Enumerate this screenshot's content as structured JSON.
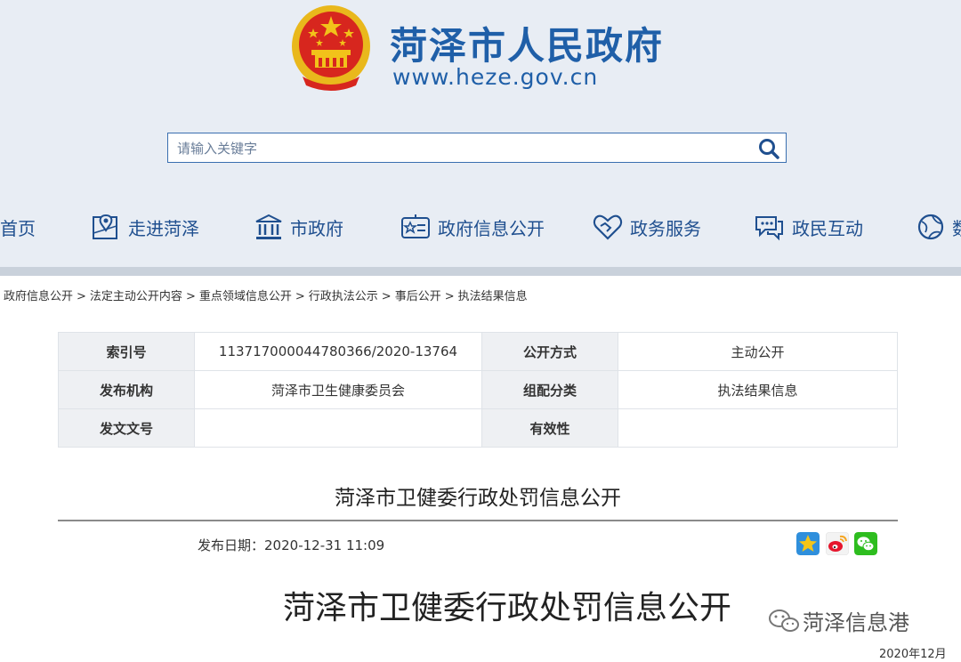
{
  "header": {
    "title": "菏泽市人民政府",
    "url": "www.heze.gov.cn"
  },
  "search": {
    "placeholder": "请输入关键字"
  },
  "nav": {
    "items": [
      {
        "label": "首页",
        "icon": "home-icon"
      },
      {
        "label": "走进菏泽",
        "icon": "map-pin-icon"
      },
      {
        "label": "市政府",
        "icon": "government-building-icon"
      },
      {
        "label": "政府信息公开",
        "icon": "info-board-icon"
      },
      {
        "label": "政务服务",
        "icon": "handshake-heart-icon"
      },
      {
        "label": "政民互动",
        "icon": "chat-bubble-icon"
      },
      {
        "label": "数",
        "icon": "globe-icon"
      }
    ]
  },
  "breadcrumb": [
    "政府信息公开",
    "法定主动公开内容",
    "重点领域信息公开",
    "行政执法公示",
    "事后公开",
    "执法结果信息"
  ],
  "meta": {
    "index_label": "索引号",
    "index_value": "113717000044780366/2020-13764",
    "mode_label": "公开方式",
    "mode_value": "主动公开",
    "org_label": "发布机构",
    "org_value": "菏泽市卫生健康委员会",
    "category_label": "组配分类",
    "category_value": "执法结果信息",
    "docno_label": "发文文号",
    "docno_value": "",
    "validity_label": "有效性",
    "validity_value": ""
  },
  "article": {
    "title": "菏泽市卫健委行政处罚信息公开",
    "pubdate_label": "发布日期：",
    "pubdate_value": "2020-12-31 11:09",
    "big_title": "菏泽市卫健委行政处罚信息公开",
    "date_corner": "2020年12月"
  },
  "watermark": "菏泽信息港",
  "colors": {
    "brand": "#1f5fa8",
    "header_bg": "#e8edf4",
    "emblem_red": "#d7261e",
    "emblem_gold": "#f2c21a"
  }
}
